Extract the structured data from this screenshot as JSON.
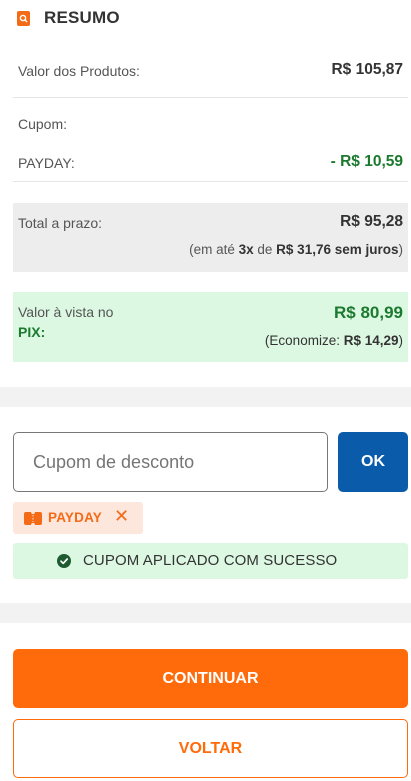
{
  "summary": {
    "title": "RESUMO",
    "products_label": "Valor dos Produtos:",
    "products_value": "R$ 105,87",
    "coupon_label": "Cupom:",
    "coupon_code_label": "PAYDAY:",
    "coupon_discount": "- R$ 10,59",
    "installment_label": "Total a prazo:",
    "installment_value": "R$ 95,28",
    "installment_prefix": "(em até ",
    "installment_count": "3x",
    "installment_mid": " de ",
    "installment_amount": "R$ 31,76 sem juros",
    "installment_suffix": ")",
    "pix_label": "Valor à vista no",
    "pix_label_bold": "PIX:",
    "pix_value": "R$ 80,99",
    "pix_save_prefix": "(Economize: ",
    "pix_save_amount": "R$ 14,29",
    "pix_save_suffix": ")"
  },
  "coupon": {
    "input_placeholder": "Cupom de desconto",
    "ok_label": "OK",
    "applied_code": "PAYDAY",
    "remove_glyph": "✕",
    "success_message": "CUPOM APLICADO COM SUCESSO"
  },
  "actions": {
    "continue_label": "CONTINUAR",
    "back_label": "VOLTAR"
  },
  "colors": {
    "brand_orange": "#ff6a0a",
    "primary_blue": "#0a5cab",
    "success_green": "#1b7a2e",
    "success_bg": "#ddf8e2"
  }
}
